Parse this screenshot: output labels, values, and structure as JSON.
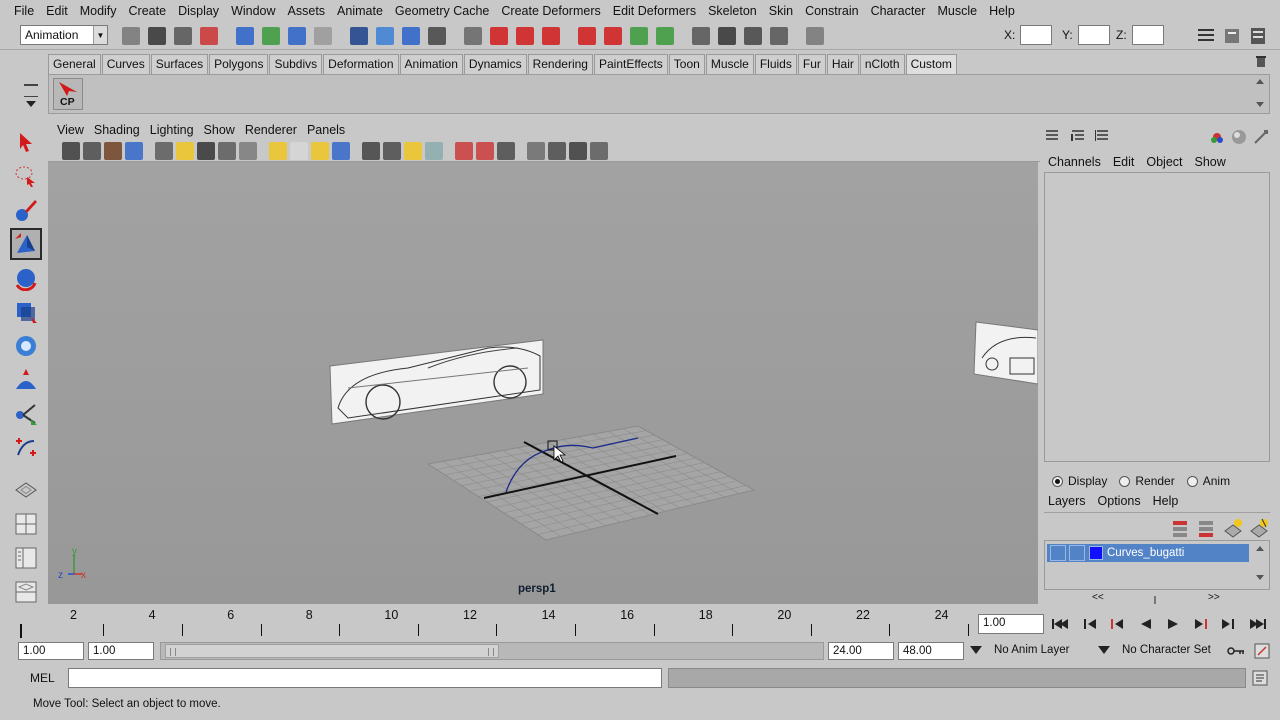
{
  "menubar": {
    "items": [
      "File",
      "Edit",
      "Modify",
      "Create",
      "Display",
      "Window",
      "Assets",
      "Animate",
      "Geometry Cache",
      "Create Deformers",
      "Edit Deformers",
      "Skeleton",
      "Skin",
      "Constrain",
      "Character",
      "Muscle",
      "Help"
    ]
  },
  "statusline": {
    "menu_set": "Animation",
    "x_label": "X:",
    "y_label": "Y:",
    "z_label": "Z:"
  },
  "shelf": {
    "tabs": [
      "General",
      "Curves",
      "Surfaces",
      "Polygons",
      "Subdivs",
      "Deformation",
      "Animation",
      "Dynamics",
      "Rendering",
      "PaintEffects",
      "Toon",
      "Muscle",
      "Fluids",
      "Fur",
      "Hair",
      "nCloth",
      "Custom"
    ],
    "active_tab": "Custom",
    "items": [
      {
        "label": "CP"
      }
    ]
  },
  "panel": {
    "menus": [
      "View",
      "Shading",
      "Lighting",
      "Show",
      "Renderer",
      "Panels"
    ],
    "camera_label": "persp1"
  },
  "axis_gizmo": {
    "y": "y",
    "z": "z",
    "x": "x"
  },
  "channelbox": {
    "menus": [
      "Channels",
      "Edit",
      "Object",
      "Show"
    ]
  },
  "layers": {
    "modes": [
      {
        "label": "Display",
        "selected": true
      },
      {
        "label": "Render",
        "selected": false
      },
      {
        "label": "Anim",
        "selected": false
      }
    ],
    "menus": [
      "Layers",
      "Options",
      "Help"
    ],
    "items": [
      {
        "name": "Curves_bugatti",
        "color": "#1010ff"
      }
    ],
    "scroll_left": "<<",
    "scroll_right": ">>"
  },
  "timeline": {
    "ticks": [
      "2",
      "4",
      "6",
      "8",
      "10",
      "12",
      "14",
      "16",
      "18",
      "20",
      "22",
      "24"
    ],
    "current_frame": "1.00",
    "range_start": "1.00",
    "playback_start": "1.00",
    "playback_end": "24.00",
    "range_end": "48.00",
    "anim_layer": "No Anim Layer",
    "character_set": "No Character Set"
  },
  "command": {
    "mel_label": "MEL",
    "value": ""
  },
  "helpline": {
    "text": "Move Tool: Select an object to move."
  },
  "colors": {
    "viewport_bg": "#9c9c9c",
    "ui_bg": "#c8c8c8",
    "layer_highlight": "#5283c7",
    "curve": "#1a2a8a"
  }
}
